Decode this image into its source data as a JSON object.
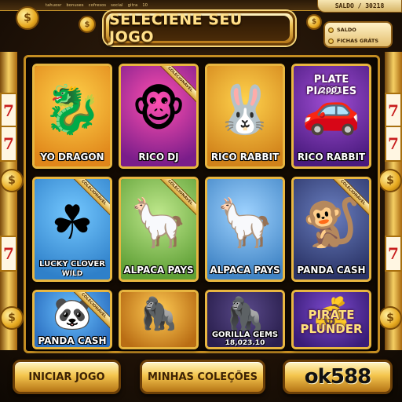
{
  "top_nav": [
    "tahuosr",
    "bonuses",
    "cofresos",
    "social",
    "gitra",
    "10"
  ],
  "saldo_top": "SALDO / 30218",
  "title": "SELECIENE SEU JOGO",
  "info_panel": {
    "saldo_label": "SALDO",
    "fichas_label": "FICHAS GRÁTS"
  },
  "reel_symbol": "7",
  "coin_symbol": "$",
  "ribbon_text": "COLECIONÁVEL",
  "games": [
    {
      "label": "YO DRAGON",
      "icon": "dragon-icon",
      "glyph": "🐉",
      "bg": [
        "#ffd24a",
        "#e0861a"
      ]
    },
    {
      "label": "RICO DJ",
      "icon": "monkey-dj-icon",
      "glyph": "🐵",
      "bg": [
        "#ff4fb0",
        "#7a1d8a"
      ],
      "ribbon": true
    },
    {
      "label": "RICO RABBIT",
      "icon": "rabbit-icon",
      "glyph": "🐰",
      "bg": [
        "#ffd34d",
        "#d1821a"
      ]
    },
    {
      "label": "RICO RABBIT",
      "icon": "car-icon",
      "glyph": "🚗",
      "bg": [
        "#a24ed6",
        "#4a1b7e"
      ],
      "top_title": "PLATE PIANDES",
      "top_sub": "2001"
    },
    {
      "label": "LUCKY CLOVER",
      "label2": "WILD",
      "icon": "leprechaun-icon",
      "glyph": "☘",
      "bg": [
        "#74c8ff",
        "#2f80c9"
      ],
      "ribbon": true
    },
    {
      "label": "ALPACA PAYS",
      "icon": "alpaca-icon",
      "glyph": "🦙",
      "bg": [
        "#bfe88c",
        "#5e9f35"
      ],
      "ribbon": true
    },
    {
      "label": "ALPACA PAYS",
      "icon": "alpaca-icon",
      "glyph": "🦙",
      "bg": [
        "#9fd3ff",
        "#3f83c4"
      ]
    },
    {
      "label": "PANDA CASH",
      "icon": "pirate-monkey-icon",
      "glyph": "🐒",
      "bg": [
        "#6a7fc0",
        "#2a3366"
      ],
      "ribbon": true
    },
    {
      "label": "PANDA CASH",
      "icon": "panda-icon",
      "glyph": "🐼",
      "bg": [
        "#6bc3ff",
        "#2b6ec0"
      ],
      "ribbon": true
    },
    {
      "label": "",
      "icon": "gorilla-icon",
      "glyph": "🦍",
      "bg": [
        "#ffcc55",
        "#b96d14"
      ]
    },
    {
      "label": "GORILLA GEMS",
      "label2": "18,023.10",
      "icon": "pirate-gorilla-icon",
      "glyph": "🦍",
      "bg": [
        "#5a4a8a",
        "#2a1f4e"
      ]
    },
    {
      "label": "",
      "icon": "pirate-chest-icon",
      "glyph": "💰",
      "bg": [
        "#7e4bd0",
        "#3a1d78"
      ],
      "top_title": "PIRATE PLUNDER"
    }
  ],
  "buttons": {
    "start": "INICIAR JOGO",
    "collections": "MINHAS COLEÇÕES",
    "logo": "ok588"
  }
}
